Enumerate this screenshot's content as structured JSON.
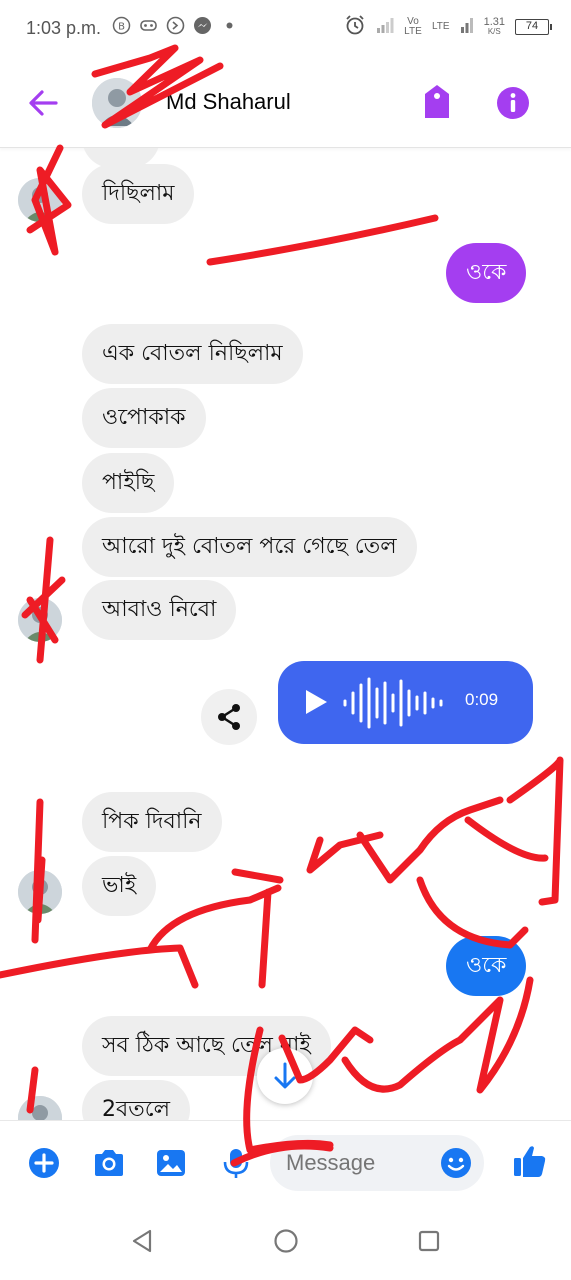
{
  "status_bar": {
    "time": "1:03 p.m.",
    "net_type_1": "Vo LTE",
    "net_type_2": "LTE",
    "speed_value": "1.31",
    "speed_unit": "K/S",
    "battery": "74"
  },
  "header": {
    "contact_name": "Md Shaharul"
  },
  "messages": {
    "m1": "দিছিলাম",
    "m2": "ওকে",
    "m3": "এক বোতল নিছিলাম",
    "m4": "ওপোকাক",
    "m5": "পাইছি",
    "m6": "আরো দুই বোতল পরে গেছে তেল",
    "m7": "আবাও নিবো",
    "audio_duration": "0:09",
    "m8": "পিক দিবানি",
    "m9": "ভাই",
    "m10": "ওকে",
    "m11": "সব ঠিক আছে তেল নাই",
    "m12": "2বতলে"
  },
  "composer": {
    "placeholder": "Message"
  },
  "colors": {
    "accent_purple": "#a43ef0",
    "messenger_blue": "#1877f2",
    "audio_blue": "#3f66ef",
    "scribble_red": "#ee1c25"
  }
}
